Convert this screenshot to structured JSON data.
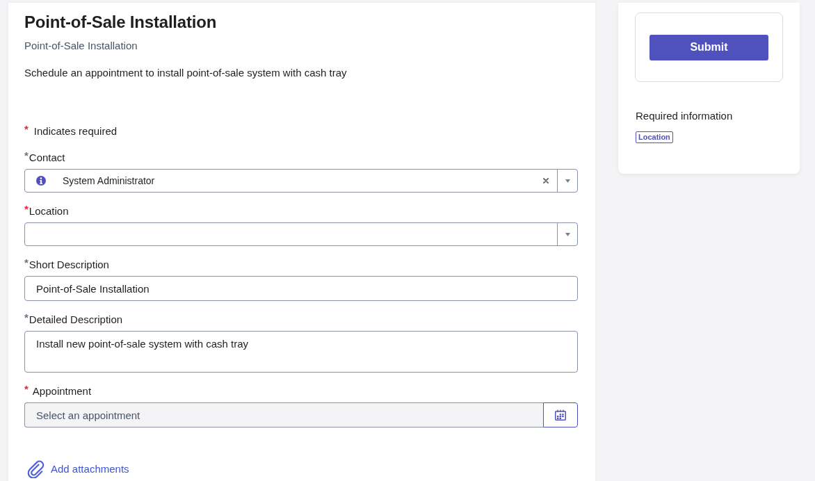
{
  "header": {
    "title": "Point-of-Sale Installation",
    "subtitle": "Point-of-Sale Installation",
    "description": "Schedule an appointment to install point-of-sale system with cash tray"
  },
  "required_note": {
    "marker": "*",
    "text": "Indicates required"
  },
  "fields": [
    {
      "kind": "reference",
      "label": "Contact",
      "marker": "*",
      "satisfied": true,
      "value": "System Administrator",
      "clearable": true
    },
    {
      "kind": "reference",
      "label": "Location",
      "marker": "*",
      "satisfied": false,
      "clearable": false
    },
    {
      "kind": "text",
      "label": "Short Description",
      "marker": "*",
      "satisfied": true,
      "value": "Point-of-Sale Installation"
    },
    {
      "kind": "textarea",
      "label": "Detailed Description",
      "marker": "*",
      "satisfied": true,
      "value": "Install new point-of-sale system with cash tray"
    },
    {
      "kind": "date_picker",
      "label": "Appointment",
      "marker": "*",
      "satisfied": false,
      "placeholder": "Select an appointment"
    }
  ],
  "attachments": {
    "label": "Add attachments"
  },
  "sidebar": {
    "submit": {
      "label": "Submit"
    },
    "required_info": {
      "title": "Required information",
      "tags": [
        "Location"
      ]
    }
  }
}
